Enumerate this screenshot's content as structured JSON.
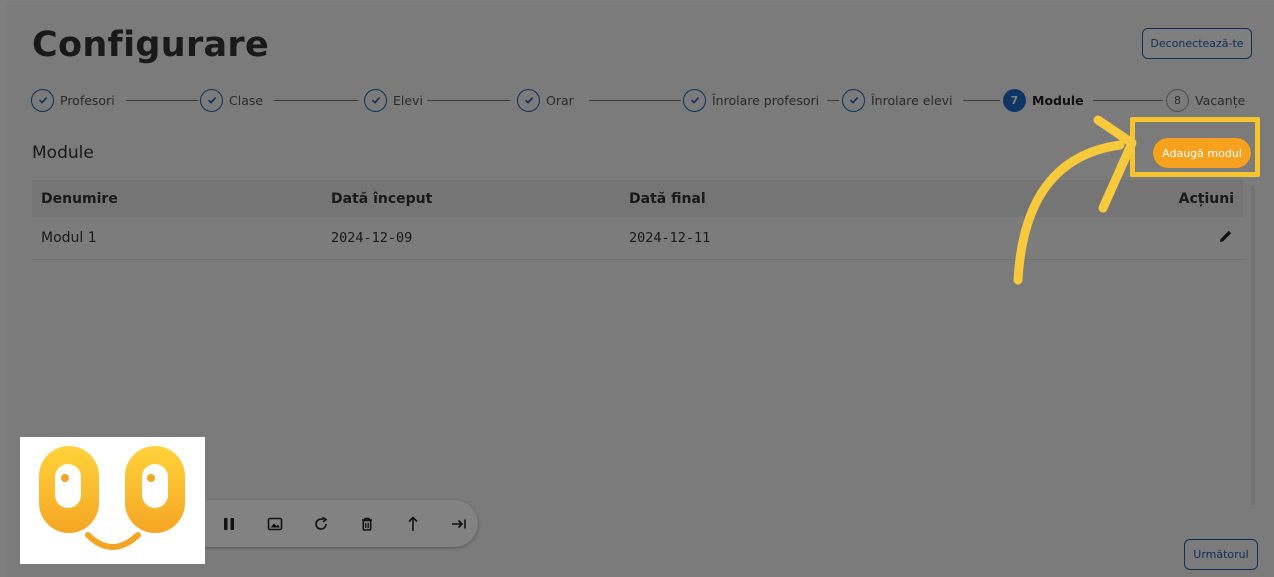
{
  "header": {
    "title": "Configurare",
    "logout_label": "Deconectează-te"
  },
  "stepper": {
    "steps": [
      {
        "label": "Profesori",
        "state": "done",
        "marker": ""
      },
      {
        "label": "Clase",
        "state": "done",
        "marker": ""
      },
      {
        "label": "Elevi",
        "state": "done",
        "marker": ""
      },
      {
        "label": "Orar",
        "state": "done",
        "marker": ""
      },
      {
        "label": "Înrolare profesori",
        "state": "done",
        "marker": ""
      },
      {
        "label": "Înrolare elevi",
        "state": "done",
        "marker": ""
      },
      {
        "label": "Module",
        "state": "active",
        "marker": "7"
      },
      {
        "label": "Vacanțe",
        "state": "todo",
        "marker": "8"
      }
    ]
  },
  "section": {
    "title": "Module",
    "add_label": "Adaugă modul"
  },
  "table": {
    "columns": [
      "Denumire",
      "Dată început",
      "Dată final",
      "Acțiuni"
    ],
    "rows": [
      {
        "name": "Modul 1",
        "start": "2024-12-09",
        "end": "2024-12-11"
      }
    ]
  },
  "footer": {
    "next_label": "Următorul"
  },
  "colors": {
    "primary": "#1f6bc9",
    "accent": "#f6a21e",
    "highlight": "#f5c42e",
    "arrow": "#f7c93c"
  },
  "icons": {
    "edit": "pencil-icon",
    "check": "check-icon"
  },
  "player": {
    "controls": [
      "pause-icon",
      "image-icon",
      "redo-icon",
      "trash-icon",
      "share-up-icon",
      "skip-end-icon"
    ]
  }
}
